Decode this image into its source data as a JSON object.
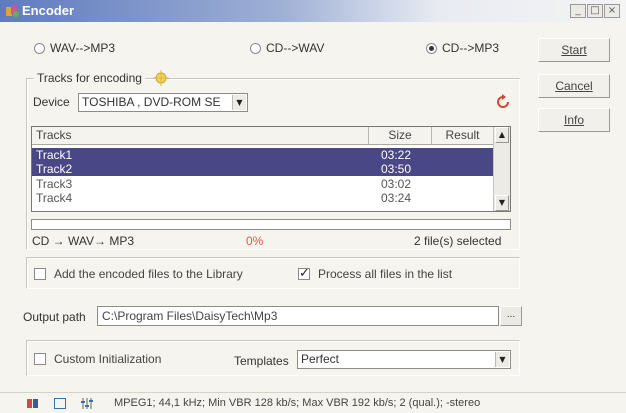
{
  "window": {
    "title": "Encoder",
    "controls": [
      "_",
      "□",
      "×"
    ]
  },
  "modes": [
    {
      "label": "WAV-->MP3",
      "selected": false
    },
    {
      "label": "CD-->WAV",
      "selected": false
    },
    {
      "label": "CD-->MP3",
      "selected": true
    }
  ],
  "side_buttons": {
    "start": "Start",
    "cancel": "Cancel",
    "info": "Info"
  },
  "tracks_group": {
    "label": "Tracks for encoding",
    "device_label": "Device",
    "device_value": "TOSHIBA , DVD-ROM SE"
  },
  "track_list": {
    "columns": [
      "Tracks",
      "Size",
      "Result"
    ],
    "rows": [
      {
        "name": "Track1",
        "size": "03:22",
        "result": "",
        "selected": true
      },
      {
        "name": "Track2",
        "size": "03:50",
        "result": "",
        "selected": true
      },
      {
        "name": "Track3",
        "size": "03:02",
        "result": "",
        "selected": false
      },
      {
        "name": "Track4",
        "size": "03:24",
        "result": "",
        "selected": false
      }
    ]
  },
  "progress": {
    "mode_text": "CD → WAV→ MP3",
    "percent_text": "0%",
    "value": 0,
    "selected_text": "2 file(s) selected"
  },
  "options": {
    "add_to_library_label": "Add the encoded files to the Library",
    "add_to_library_checked": false,
    "process_all_label": "Process all files in the list",
    "process_all_checked": true
  },
  "output": {
    "label": "Output path",
    "value": "C:\\Program Files\\DaisyTech\\Mp3",
    "browse_label": "..."
  },
  "init": {
    "custom_label": "Custom Initialization",
    "custom_checked": false,
    "templates_label": "Templates",
    "templates_value": "Perfect"
  },
  "status": {
    "text": "MPEG1; 44,1 kHz; Min VBR 128 kb/s; Max VBR 192 kb/s; 2 (qual.); -stereo"
  },
  "colors": {
    "selection": "#4a4786",
    "title_gradient_start": "#5f7bbf",
    "percent_red": "#e0564a"
  }
}
